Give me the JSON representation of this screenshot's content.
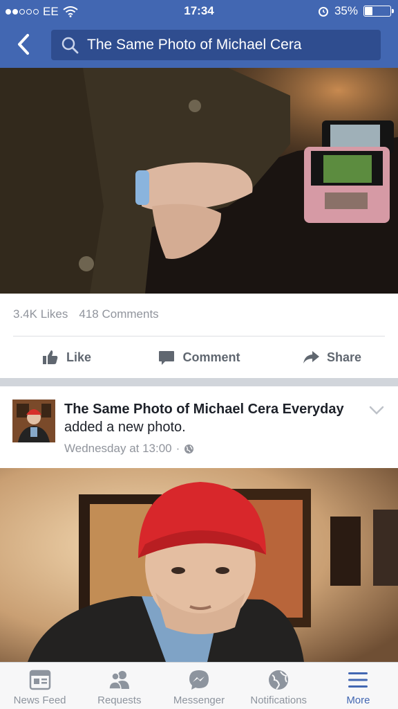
{
  "status_bar": {
    "carrier": "EE",
    "time": "17:34",
    "battery_percent": "35%",
    "battery_level": 0.35
  },
  "search": {
    "query": "The Same Photo of Michael Cera"
  },
  "post1": {
    "likes": "3.4K Likes",
    "comments": "418 Comments",
    "actions": {
      "like": "Like",
      "comment": "Comment",
      "share": "Share"
    }
  },
  "post2": {
    "page_name": "The Same Photo of Michael Cera Everyday",
    "action_text": " added a new photo.",
    "timestamp": "Wednesday at 13:00",
    "separator": "·"
  },
  "tabbar": {
    "items": [
      {
        "label": "News Feed",
        "icon": "news-feed-icon"
      },
      {
        "label": "Requests",
        "icon": "friend-requests-icon"
      },
      {
        "label": "Messenger",
        "icon": "messenger-icon"
      },
      {
        "label": "Notifications",
        "icon": "globe-icon"
      },
      {
        "label": "More",
        "icon": "hamburger-menu-icon"
      }
    ],
    "active_index": 4
  },
  "colors": {
    "brand": "#4267b2",
    "search_bg": "#2f4d8f",
    "muted_text": "#90949c",
    "action_text": "#606770"
  }
}
